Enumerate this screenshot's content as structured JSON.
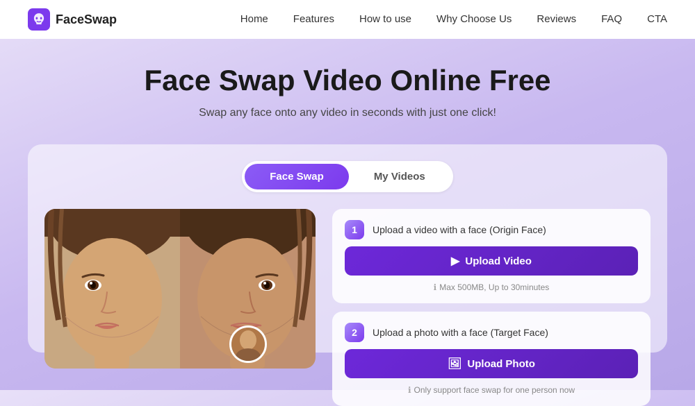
{
  "nav": {
    "logo_text": "FaceSwap",
    "links": [
      {
        "label": "Home",
        "id": "home"
      },
      {
        "label": "Features",
        "id": "features"
      },
      {
        "label": "How to use",
        "id": "how-to-use"
      },
      {
        "label": "Why Choose Us",
        "id": "why-choose-us"
      },
      {
        "label": "Reviews",
        "id": "reviews"
      },
      {
        "label": "FAQ",
        "id": "faq"
      },
      {
        "label": "CTA",
        "id": "cta"
      }
    ]
  },
  "hero": {
    "title": "Face Swap Video Online Free",
    "subtitle": "Swap any face onto any video in seconds with just one click!"
  },
  "tabs": [
    {
      "label": "Face Swap",
      "id": "face-swap",
      "active": true
    },
    {
      "label": "My Videos",
      "id": "my-videos",
      "active": false
    }
  ],
  "steps": [
    {
      "number": "1",
      "label": "Upload a video with a face  (Origin Face)",
      "button_label": "Upload Video",
      "hint": "Max 500MB, Up to 30minutes"
    },
    {
      "number": "2",
      "label": "Upload a photo with a face  (Target Face)",
      "button_label": "Upload Photo",
      "hint": "Only support face swap for one person now"
    }
  ]
}
